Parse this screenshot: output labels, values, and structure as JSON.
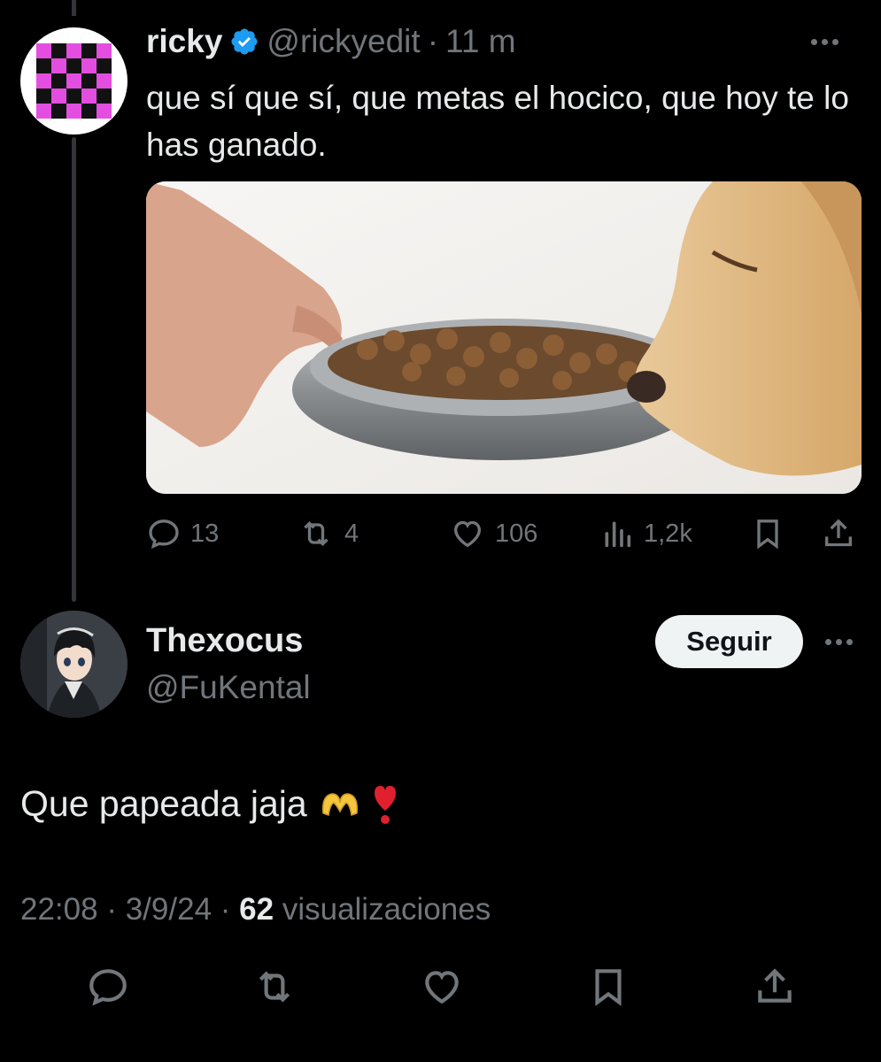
{
  "parent_tweet": {
    "display_name": "ricky",
    "handle": "@rickyedit",
    "separator": "·",
    "time": "11 m",
    "text": "que sí que sí, que metas el hocico, que hoy te lo has ganado.",
    "avatar_icon": "checkerboard-avatar",
    "media_description_icon": "dog-food-photo",
    "stats": {
      "replies": "13",
      "reposts": "4",
      "likes": "106",
      "views": "1,2k"
    }
  },
  "reply": {
    "display_name": "Thexocus",
    "handle": "@FuKental",
    "follow_label": "Seguir",
    "text": "Que papeada jaja",
    "emoji_1": "🫶",
    "emoji_2": "❣️",
    "time": "22:08",
    "separator": "·",
    "date": "3/9/24",
    "views_count": "62",
    "views_label": "visualizaciones"
  },
  "colors": {
    "background": "#000000",
    "text": "#e7e9ea",
    "muted": "#71767b",
    "verified": "#1d9bf0",
    "checker": "#e34ee0"
  }
}
